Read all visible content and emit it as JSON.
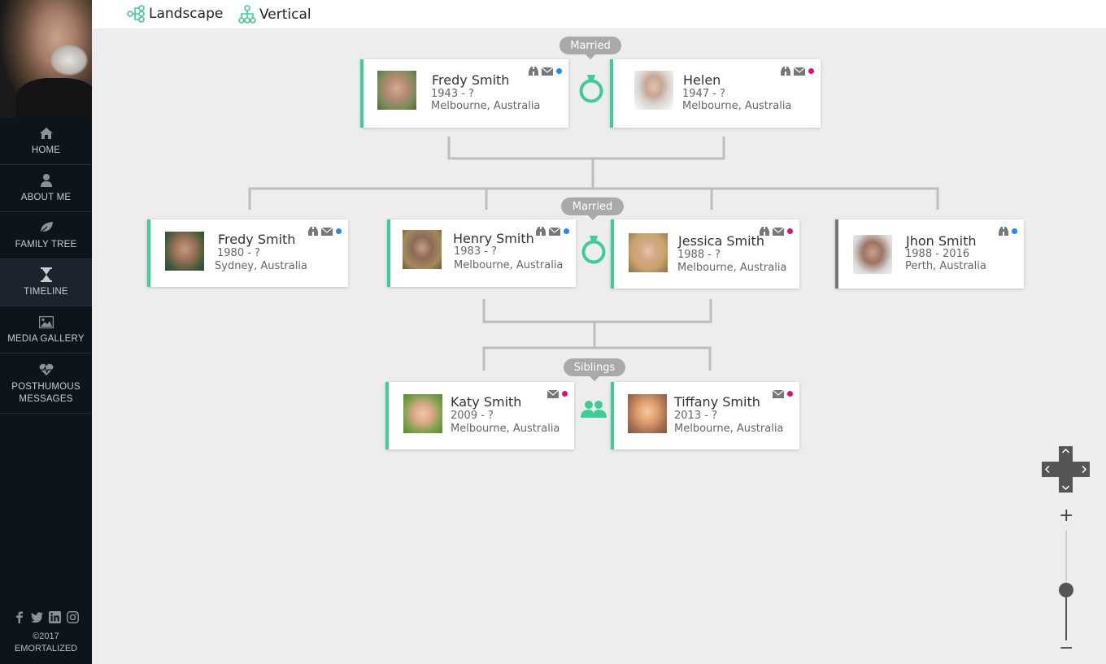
{
  "sidebar": {
    "nav": [
      {
        "label": "HOME",
        "icon": "home-icon"
      },
      {
        "label": "ABOUT ME",
        "icon": "user-icon"
      },
      {
        "label": "FAMILY TREE",
        "icon": "leaf-icon"
      },
      {
        "label": "TIMELINE",
        "icon": "hourglass-icon"
      },
      {
        "label": "MEDIA GALLERY",
        "icon": "image-icon"
      },
      {
        "label": "POSTHUMOUS MESSAGES",
        "icon": "heartbeat-icon"
      }
    ],
    "active_item": "TIMELINE",
    "social": [
      "facebook-icon",
      "twitter-icon",
      "linkedin-icon",
      "instagram-icon"
    ],
    "copyright_year": "©2017",
    "brand": "EMORTALIZED"
  },
  "toolbar": {
    "landscape_label": "Landscape",
    "vertical_label": "Vertical"
  },
  "relations": {
    "married_top": "Married",
    "married_mid": "Married",
    "siblings": "Siblings"
  },
  "people": {
    "p1": {
      "name": "Fredy Smith",
      "years": "1943 - ?",
      "place": "Melbourne, Australia",
      "gender_color": "#1a8cff",
      "has_search": true
    },
    "p2": {
      "name": "Helen",
      "years": "1947 - ?",
      "place": "Melbourne, Australia",
      "gender_color": "#e0106e",
      "has_search": true
    },
    "p3": {
      "name": "Fredy Smith",
      "years": "1980 - ?",
      "place": "Sydney, Australia",
      "gender_color": "#1a8cff",
      "has_search": true
    },
    "p4": {
      "name": "Henry Smith",
      "years": "1983 - ?",
      "place": "Melbourne, Australia",
      "gender_color": "#1a8cff",
      "has_search": true
    },
    "p5": {
      "name": "Jessica Smith",
      "years": "1988 - ?",
      "place": "Melbourne, Australia",
      "gender_color": "#e0106e",
      "has_search": true
    },
    "p6": {
      "name": "Jhon Smith",
      "years": "1988 - 2016",
      "place": "Perth, Australia",
      "gender_color": "#1a8cff",
      "has_search": true
    },
    "p7": {
      "name": "Katy Smith",
      "years": "2009 - ?",
      "place": "Melbourne, Australia",
      "gender_color": "#e0106e",
      "has_search": false
    },
    "p8": {
      "name": "Tiffany Smith",
      "years": "2013 - ?",
      "place": "Melbourne, Australia",
      "gender_color": "#e0106e",
      "has_search": false
    }
  },
  "colors": {
    "accent": "#3fcd97",
    "sidebar_bg": "#0d141b",
    "male": "#1a8cff",
    "female": "#e0106e",
    "deceased_border": "#777777"
  },
  "zoom": {
    "plus": "+",
    "minus": "−",
    "level": 0.47
  }
}
